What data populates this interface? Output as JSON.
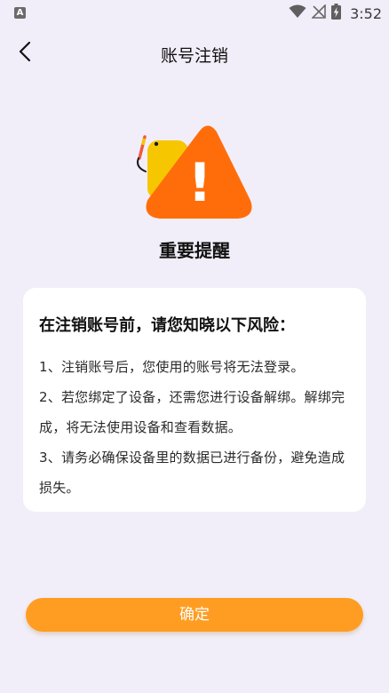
{
  "status_bar": {
    "app_badge": "A",
    "time": "3:52"
  },
  "header": {
    "title": "账号注销"
  },
  "alert": {
    "title": "重要提醒",
    "icon_glyph": "!"
  },
  "card": {
    "heading": "在注销账号前，请您知晓以下风险：",
    "items": [
      "1、注销账号后，您使用的账号将无法登录。",
      "2、若您绑定了设备，还需您进行设备解绑。解绑完成，将无法使用设备和查看数据。",
      "3、请务必确保设备里的数据已进行备份，避免造成损失。"
    ]
  },
  "footer": {
    "confirm_label": "确定"
  },
  "colors": {
    "background": "#f1eef9",
    "accent": "#ff9d22",
    "warning": "#ff6d0a",
    "mascot": "#f6c700"
  },
  "icons": {
    "back": "chevron-left-icon",
    "wifi": "wifi-icon",
    "signal": "no-signal-icon",
    "battery": "battery-charging-icon",
    "warning": "warning-triangle-icon"
  }
}
